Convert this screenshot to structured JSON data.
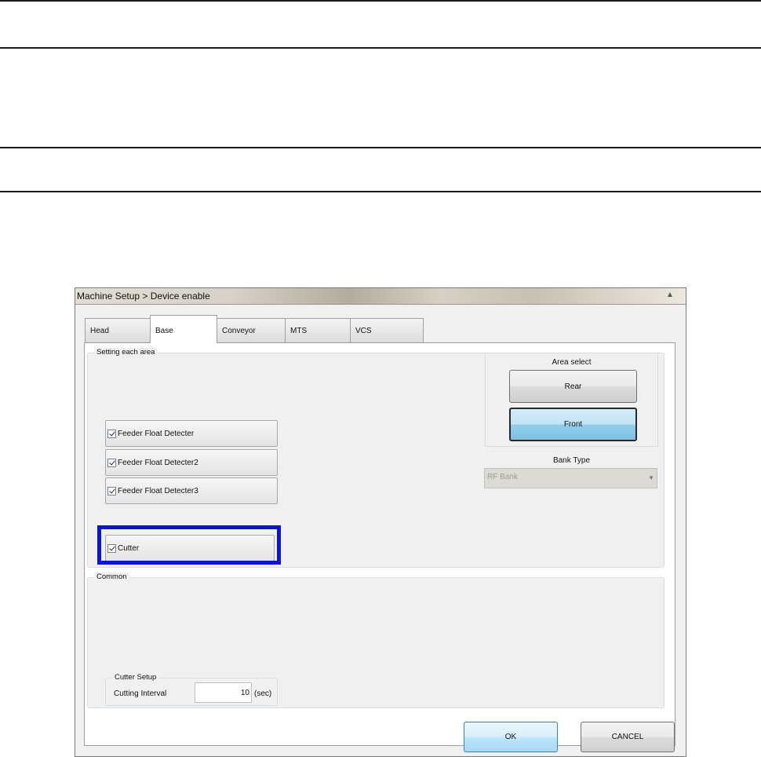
{
  "window": {
    "title": "Machine Setup > Device enable"
  },
  "tabs": [
    {
      "label": "Head",
      "active": false
    },
    {
      "label": "Base",
      "active": true
    },
    {
      "label": "Conveyor",
      "active": false
    },
    {
      "label": "MTS",
      "active": false
    },
    {
      "label": "VCS",
      "active": false
    }
  ],
  "setting_each_area": {
    "label": "Setting each area",
    "feeders": [
      {
        "label": "Feeder Float Detecter",
        "checked": true
      },
      {
        "label": "Feeder Float Detecter2",
        "checked": true
      },
      {
        "label": "Feeder Float Detecter3",
        "checked": true
      }
    ],
    "cutter": {
      "label": "Cutter",
      "checked": true
    }
  },
  "area_select": {
    "label": "Area select",
    "rear_label": "Rear",
    "front_label": "Front",
    "selected": "Front"
  },
  "bank_type": {
    "label": "Bank Type",
    "value": "RF Bank"
  },
  "common": {
    "label": "Common",
    "cutter_setup": {
      "label": "Cutter Setup",
      "interval_label": "Cutting Interval",
      "interval_value": "10",
      "unit": "(sec)"
    }
  },
  "footer": {
    "ok_label": "OK",
    "cancel_label": "CANCEL"
  },
  "colors": {
    "highlight_frame": "#0a14d6",
    "selected_button": "#94cde9"
  }
}
